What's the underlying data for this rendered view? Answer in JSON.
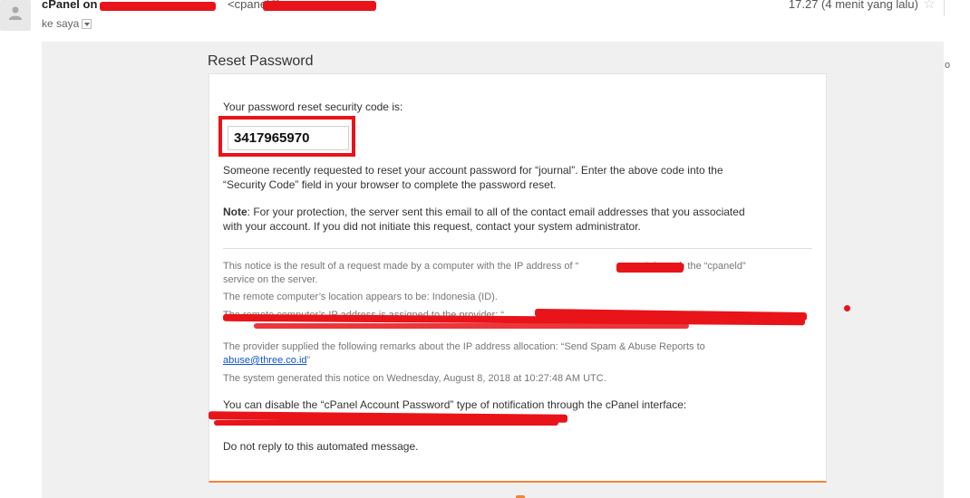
{
  "header": {
    "sender_name": "cPanel on",
    "sender_email_prefix": "<cpanel@",
    "recipient": "ke saya",
    "timestamp": "17.27 (4 menit yang lalu)",
    "star": "☆"
  },
  "side_fragment": "o",
  "email": {
    "title": "Reset Password",
    "intro": "Your password reset security code is:",
    "code": "3417965970",
    "para1_line1": "Someone recently requested to reset your account password for “journal”. Enter the above code into the",
    "para1_line2": "“Security Code” field in your browser to complete the password reset.",
    "note_label": "Note",
    "note_line1": ": For your protection, the server sent this email to all of the contact email addresses that you associated",
    "note_line2": "with your account. If you did not initiate this request, contact your system administrator.",
    "notice_line1_a": "This notice is the result of a request made by a computer with the IP address of “",
    "notice_line1_b": "” through the “cpaneld”",
    "notice_line2": "service on the server.",
    "location": "The remote computer’s location appears to be: Indonesia (ID).",
    "provider": "The remote computer’s IP address is assigned to the provider: “",
    "remarks_line1": "The provider supplied the following remarks about the IP address allocation: “Send Spam & Abuse Reports to",
    "remarks_link": "abuse@three.co.id",
    "remarks_end": "”",
    "generated": "The system generated this notice on Wednesday, August 8, 2018 at 10:27:48 AM UTC.",
    "disable": "You can disable the “cPanel Account Password” type of notification through the cPanel interface:",
    "noreply": "Do not reply to this automated message."
  },
  "colors": {
    "redaction": "#e8141a",
    "accent_orange": "#f08438",
    "link": "#1155cc"
  }
}
